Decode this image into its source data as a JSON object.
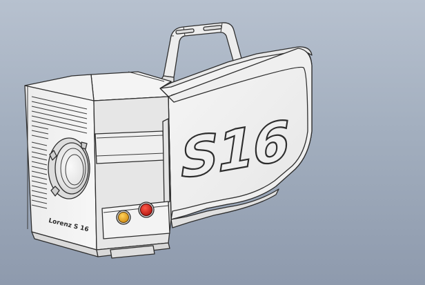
{
  "model": {
    "side_logo_text": "S16",
    "front_label_text": "Lorenz S 16"
  },
  "colors": {
    "background_top": "#b7c1cf",
    "background_bottom": "#8e9aad",
    "body_fill": "#f1f1f1",
    "body_shade": "#dcdcdc",
    "outline": "#2d2d2d",
    "lamp_yellow": "#e3a21a",
    "lamp_red": "#d7261e"
  },
  "icons": {
    "indicator_left": "amber-status-lamp",
    "indicator_right": "red-record-lamp",
    "lens_mount": "lens-mount-icon"
  }
}
